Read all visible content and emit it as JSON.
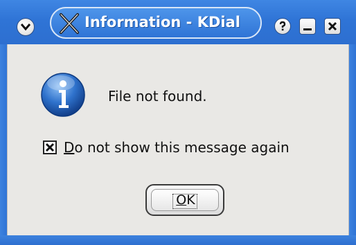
{
  "window": {
    "title": "Information - KDialog",
    "title_visible": "Information - KDial",
    "colors": {
      "titlebar": "#2f74d6",
      "body": "#e9e8e5"
    }
  },
  "titlebar_buttons": {
    "menu_icon": "chevron-down-icon",
    "help_icon": "question-icon",
    "minimize_icon": "minimize-icon",
    "close_icon": "close-icon"
  },
  "dialog": {
    "icon": "information-icon",
    "message": "File not found.",
    "checkbox": {
      "checked": true,
      "mnemonic": "D",
      "label_rest": "o not show this message again"
    },
    "ok_button": {
      "mnemonic": "O",
      "label_rest": "K"
    }
  }
}
